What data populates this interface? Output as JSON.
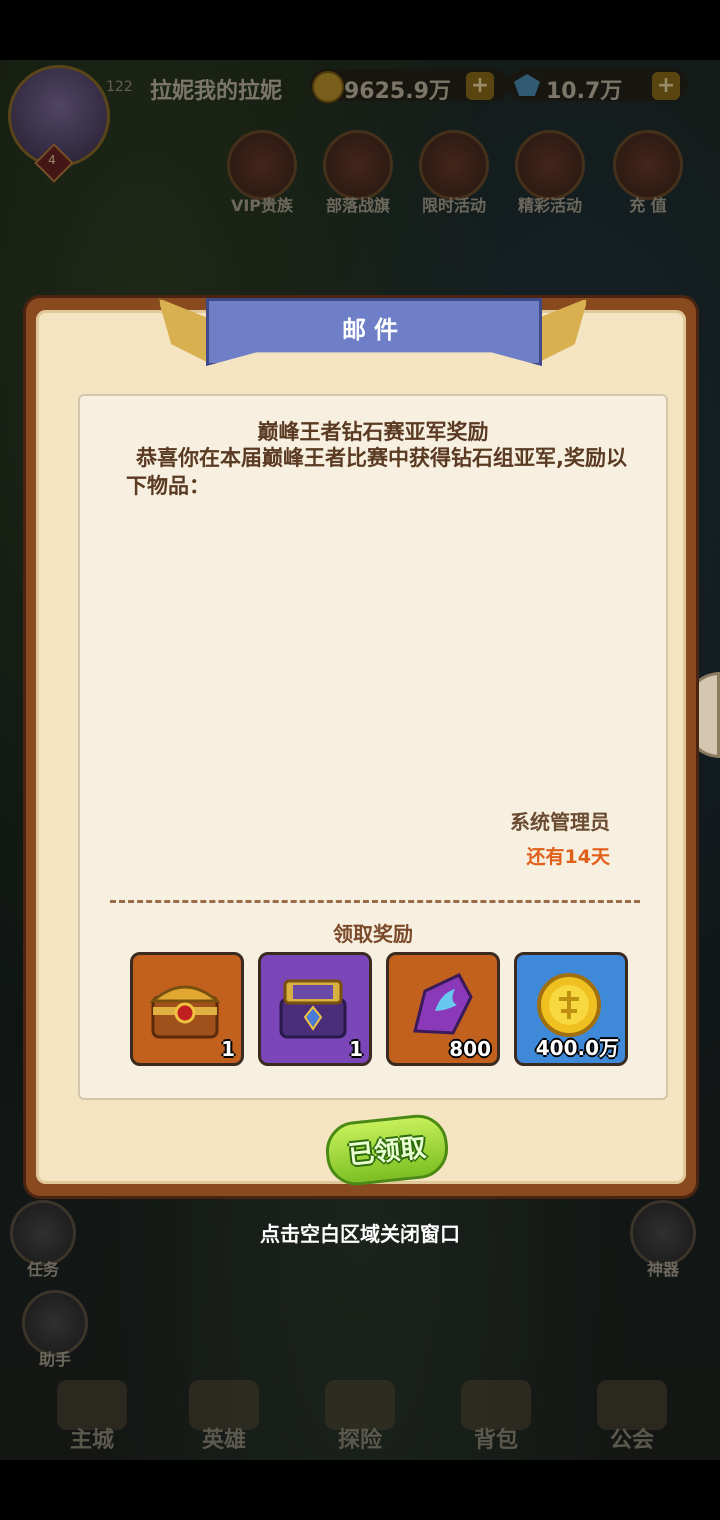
{
  "status_bar": {
    "player_id": "122",
    "player_name": "拉妮我的拉妮",
    "level": "4",
    "gold": "9625.9万",
    "diamonds": "10.7万",
    "plus_label": "+"
  },
  "activities": [
    {
      "label": "VIP贵族",
      "icon": "crown-icon"
    },
    {
      "label": "部落战旗",
      "icon": "flag-icon"
    },
    {
      "label": "限时活动",
      "icon": "clock-icon"
    },
    {
      "label": "精彩活动",
      "icon": "gift-icon"
    },
    {
      "label": "充 值",
      "icon": "gem-icon"
    }
  ],
  "side": {
    "task_label": "任务",
    "helper_label": "助手",
    "artifact_label": "神器"
  },
  "bottom_nav": [
    {
      "label": "主城",
      "icon": "castle-icon"
    },
    {
      "label": "英雄",
      "icon": "hero-icon"
    },
    {
      "label": "探险",
      "icon": "portal-icon"
    },
    {
      "label": "背包",
      "icon": "bag-icon"
    },
    {
      "label": "公会",
      "icon": "guild-icon"
    }
  ],
  "dialog": {
    "title": "邮件",
    "mail_title": "巅峰王者钻石赛亚军奖励",
    "mail_body": "恭喜你在本届巅峰王者比赛中获得钻石组亚军,奖励以下物品：",
    "sender": "系统管理员",
    "expire": "还有14天",
    "reward_title": "领取奖励",
    "rewards": [
      {
        "name": "gold-chest",
        "qty": "1",
        "bg": "#c2601e",
        "border": "#3a2a20"
      },
      {
        "name": "purple-chest",
        "qty": "1",
        "bg": "#7a46b8",
        "border": "#3a2a20"
      },
      {
        "name": "crystal-shard",
        "qty": "800",
        "bg": "#c2601e",
        "border": "#3a2a20"
      },
      {
        "name": "gold-coin",
        "qty": "400.0万",
        "bg": "#3f8ad8",
        "border": "#3a2a20"
      }
    ],
    "claimed_label": "已领取"
  },
  "close_hint": "点击空白区域关闭窗口"
}
